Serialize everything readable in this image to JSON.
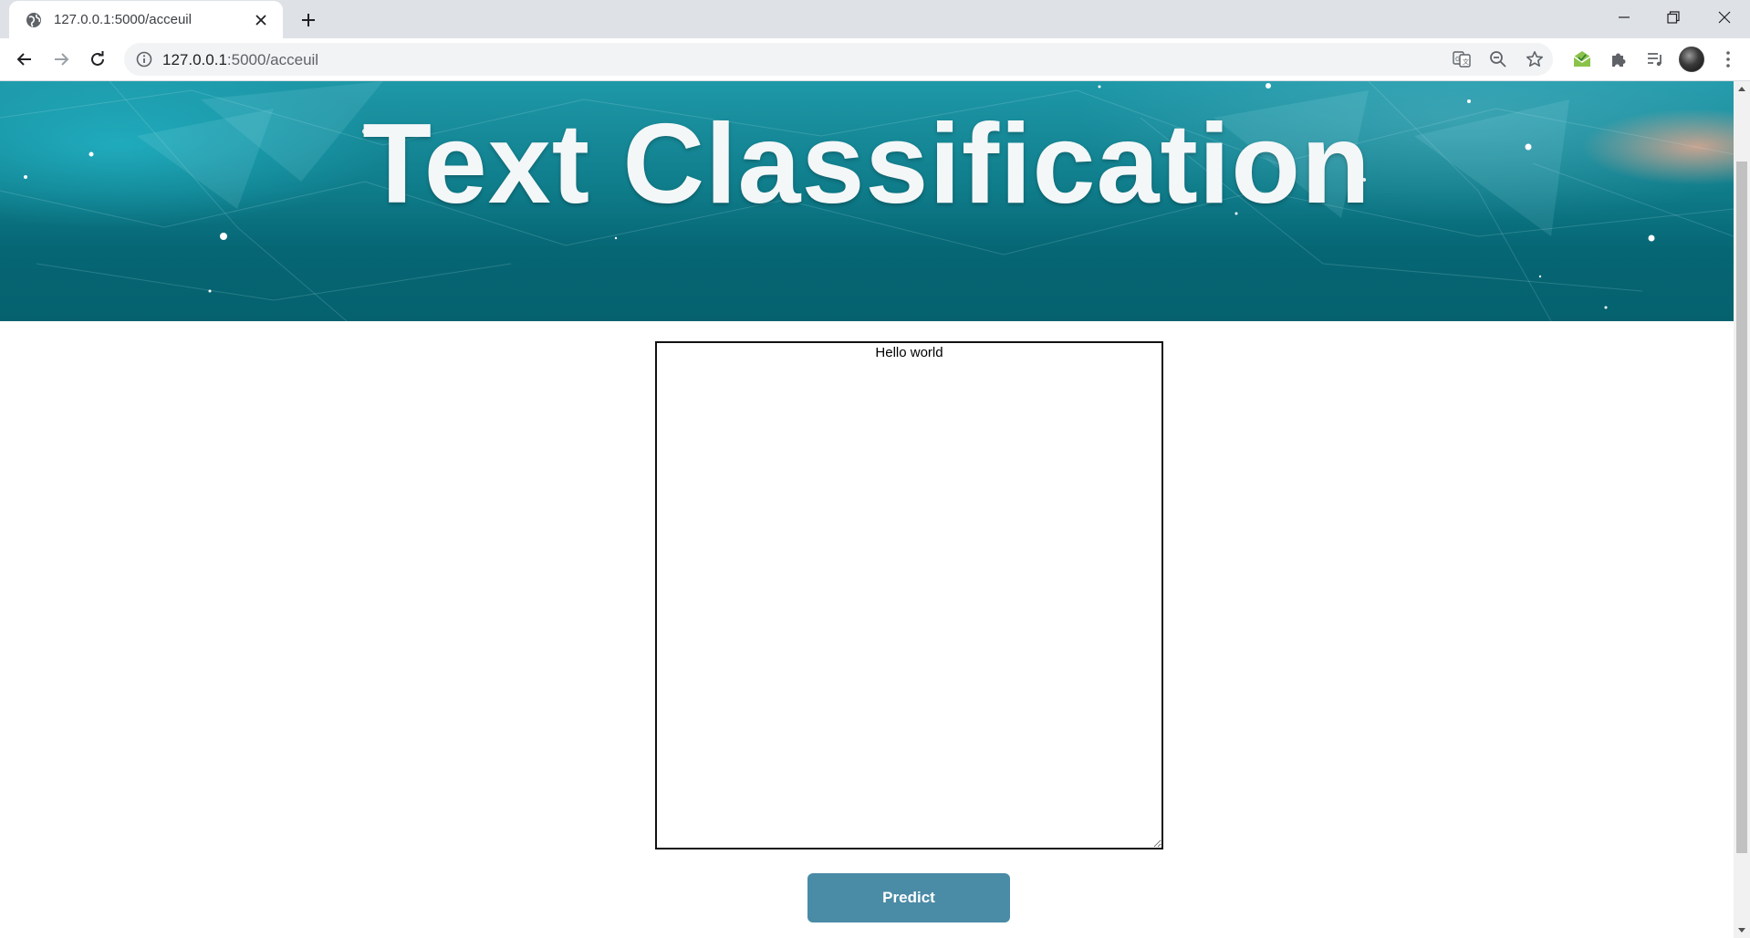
{
  "browser": {
    "tab": {
      "title": "127.0.0.1:5000/acceuil"
    },
    "address": {
      "host": "127.0.0.1",
      "path": ":5000/acceuil"
    }
  },
  "page": {
    "banner_title": "Text Classification",
    "textarea_value": "Hello world",
    "predict_label": "Predict"
  },
  "colors": {
    "banner_teal": "#066674",
    "button": "#4a8ba6",
    "text_on_dark": "#f4f7f8"
  }
}
